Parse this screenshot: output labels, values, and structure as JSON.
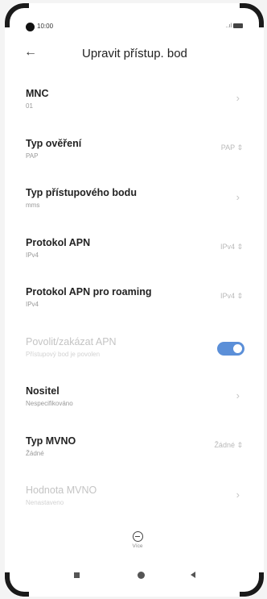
{
  "status_bar": {
    "time": "10:00",
    "signal": "..ıl"
  },
  "header": {
    "back_icon": "←",
    "title": "Upravit přístup. bod"
  },
  "rows": [
    {
      "label": "MNC",
      "sub": "01",
      "value": "",
      "chevron": "›"
    },
    {
      "label": "Typ ověření",
      "sub": "PAP",
      "value": "PAP ⇕",
      "chevron": ""
    },
    {
      "label": "Typ přístupového bodu",
      "sub": "mms",
      "value": "",
      "chevron": "›"
    },
    {
      "label": "Protokol APN",
      "sub": "IPv4",
      "value": "IPv4 ⇕",
      "chevron": ""
    },
    {
      "label": "Protokol APN pro roaming",
      "sub": "IPv4",
      "value": "IPv4 ⇕",
      "chevron": ""
    },
    {
      "label": "Povolit/zakázat APN",
      "sub": "Přístupový bod je povolen",
      "value": "",
      "chevron": "",
      "toggle_on": true,
      "disabled": true
    },
    {
      "label": "Nositel",
      "sub": "Nespecifikováno",
      "value": "",
      "chevron": "›"
    },
    {
      "label": "Typ MVNO",
      "sub": "Žádné",
      "value": "Žádné ⇕",
      "chevron": ""
    },
    {
      "label": "Hodnota MVNO",
      "sub": "Nenastaveno",
      "value": "",
      "chevron": "›",
      "disabled": true
    }
  ],
  "more": {
    "label": "Více"
  },
  "colors": {
    "toggle_on": "#5b8fd8"
  }
}
